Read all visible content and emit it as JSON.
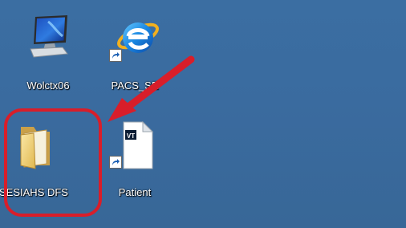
{
  "desktop": {
    "icons": [
      {
        "label": "Wolctx06",
        "icon": "computer-icon"
      },
      {
        "label": "PACS_SE",
        "icon": "internet-explorer-icon",
        "shortcut": true
      },
      {
        "label": "SESIAHS DFS",
        "icon": "folder-icon"
      },
      {
        "label": "Patient",
        "icon": "document-icon",
        "badge": "VT",
        "shortcut": true
      }
    ]
  },
  "annotations": {
    "arrow_color": "#d81e2a",
    "highlight_color": "#d81e2a"
  }
}
